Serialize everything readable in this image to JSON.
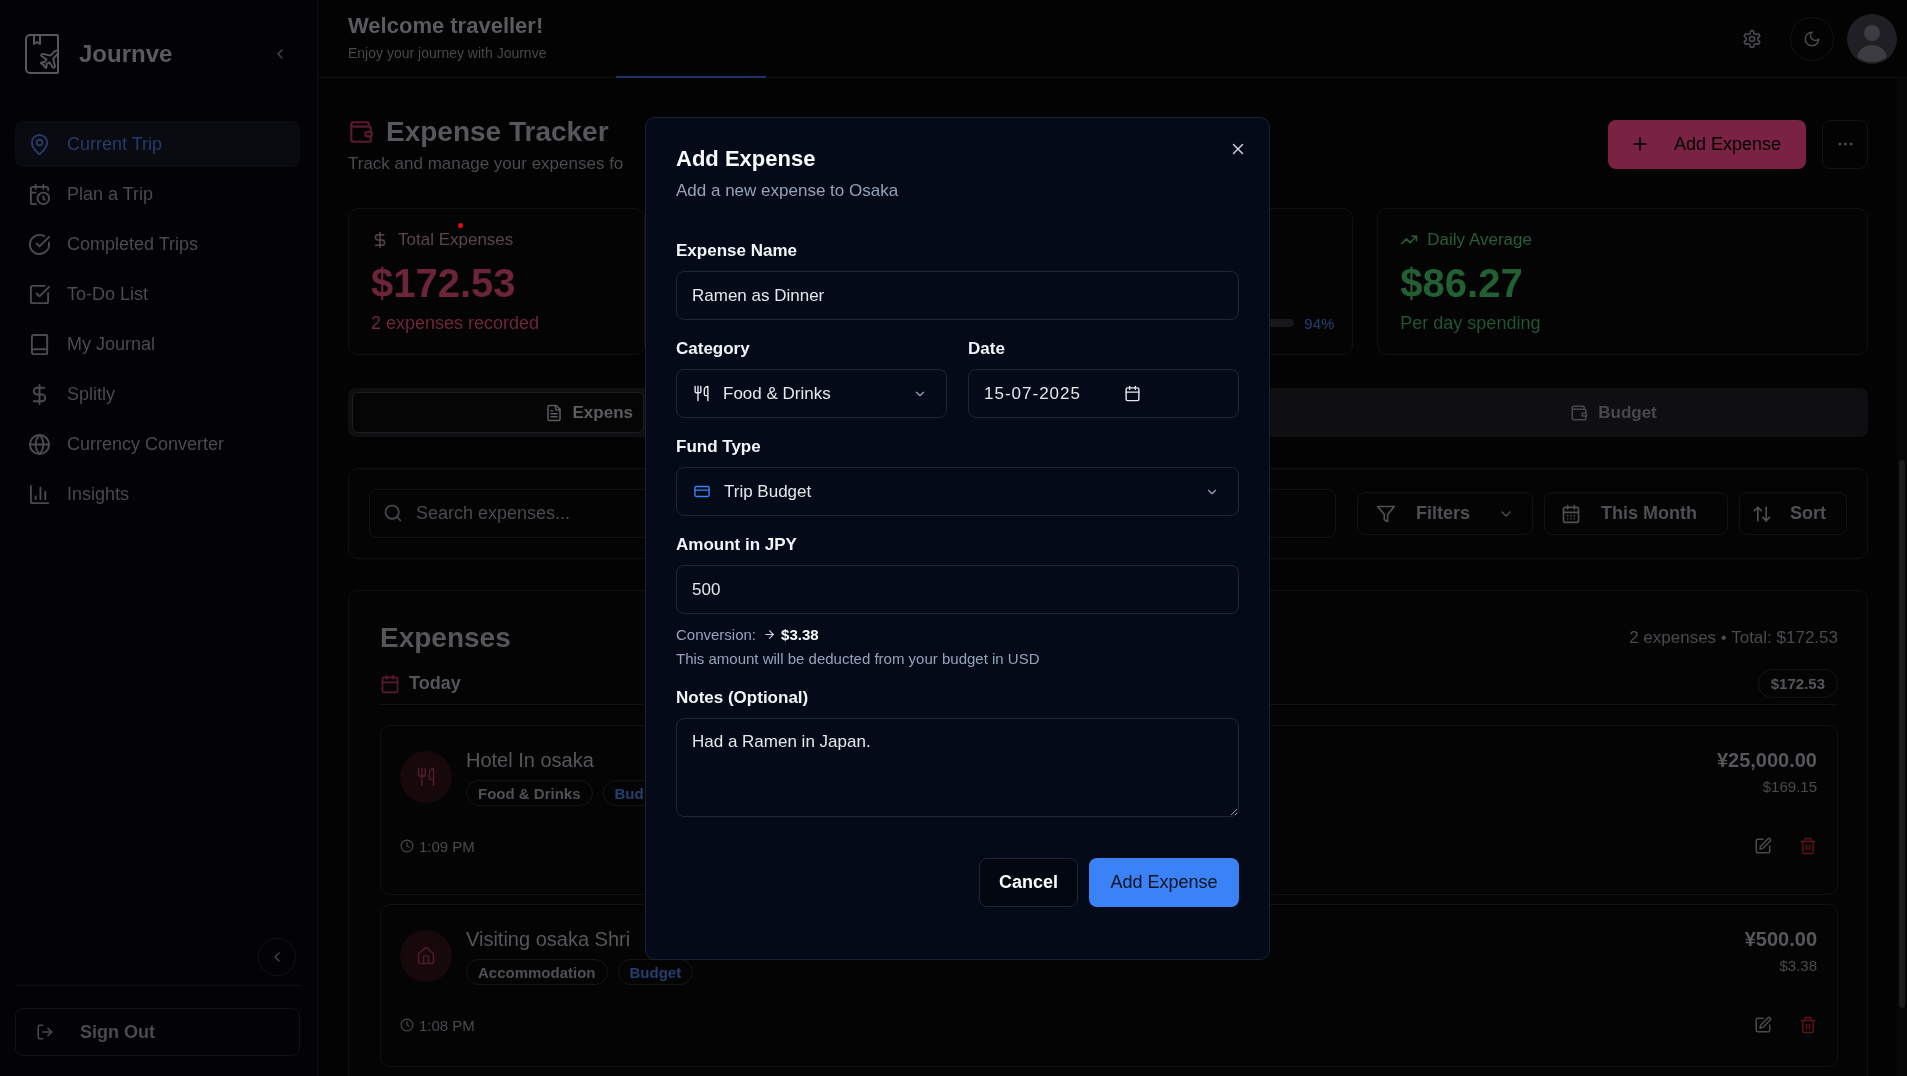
{
  "sidebar": {
    "brand": "Journve",
    "items": [
      {
        "label": "Current Trip",
        "selected": true
      },
      {
        "label": "Plan a Trip",
        "selected": false
      },
      {
        "label": "Completed Trips",
        "selected": false
      },
      {
        "label": "To-Do List",
        "selected": false
      },
      {
        "label": "My Journal",
        "selected": false
      },
      {
        "label": "Splitly",
        "selected": false
      },
      {
        "label": "Currency Converter",
        "selected": false
      },
      {
        "label": "Insights",
        "selected": false
      }
    ],
    "sign_out": "Sign Out"
  },
  "header": {
    "title": "Welcome traveller!",
    "subtitle": "Enjoy your journey with Journve"
  },
  "page": {
    "title": "Expense Tracker",
    "subtitle": "Track and manage your expenses fo",
    "add_button": "Add Expense"
  },
  "stats": [
    {
      "kind": "total",
      "label": "Total Expenses",
      "value": "$172.53",
      "note": "2 expenses recorded"
    },
    {
      "kind": "progress",
      "level": 0.94,
      "reading": "94%"
    },
    {
      "kind": "average",
      "label": "Daily Average",
      "value": "$86.27",
      "note": "Per day spending"
    }
  ],
  "tabs": [
    {
      "label": "Expens",
      "selected": true
    },
    {
      "label": "Budget",
      "selected": false
    }
  ],
  "toolbar": {
    "search": {
      "placeholder": "Search expenses..."
    },
    "filters": "Filters",
    "period": "This Month",
    "sort": "Sort"
  },
  "expenses": {
    "title": "Expenses",
    "summary": "2 expenses • Total: $172.53",
    "group": {
      "label": "Today",
      "total": "$172.53"
    },
    "items": [
      {
        "title": "Hotel In osaka",
        "tags": [
          {
            "label": "Food & Drinks",
            "kind": "category"
          },
          {
            "label": "Bud",
            "kind": "fund"
          }
        ],
        "time": "1:09 PM",
        "amount": "¥25,000.00",
        "converted": "$169.15"
      },
      {
        "title": "Visiting osaka Shri",
        "tags": [
          {
            "label": "Accommodation",
            "kind": "category"
          },
          {
            "label": "Budget",
            "kind": "fund"
          }
        ],
        "time": "1:08 PM",
        "amount": "¥500.00",
        "converted": "$3.38"
      }
    ]
  },
  "dialog": {
    "title": "Add Expense",
    "subtitle": "Add a new expense to Osaka",
    "name": {
      "label": "Expense Name",
      "value": "Ramen as Dinner"
    },
    "category": {
      "label": "Category",
      "value": "Food & Drinks"
    },
    "date": {
      "label": "Date",
      "value": "15-07-2025"
    },
    "fund_type": {
      "label": "Fund Type",
      "value": "Trip Budget"
    },
    "amount": {
      "label": "Amount in JPY",
      "value": "500"
    },
    "conversion": {
      "label": "Conversion:",
      "value": "$3.38"
    },
    "hint": "This amount will be deducted from your budget in USD",
    "notes": {
      "label": "Notes (Optional)",
      "value": "Had a Ramen in Japan."
    },
    "cancel": "Cancel",
    "submit": "Add Expense"
  }
}
